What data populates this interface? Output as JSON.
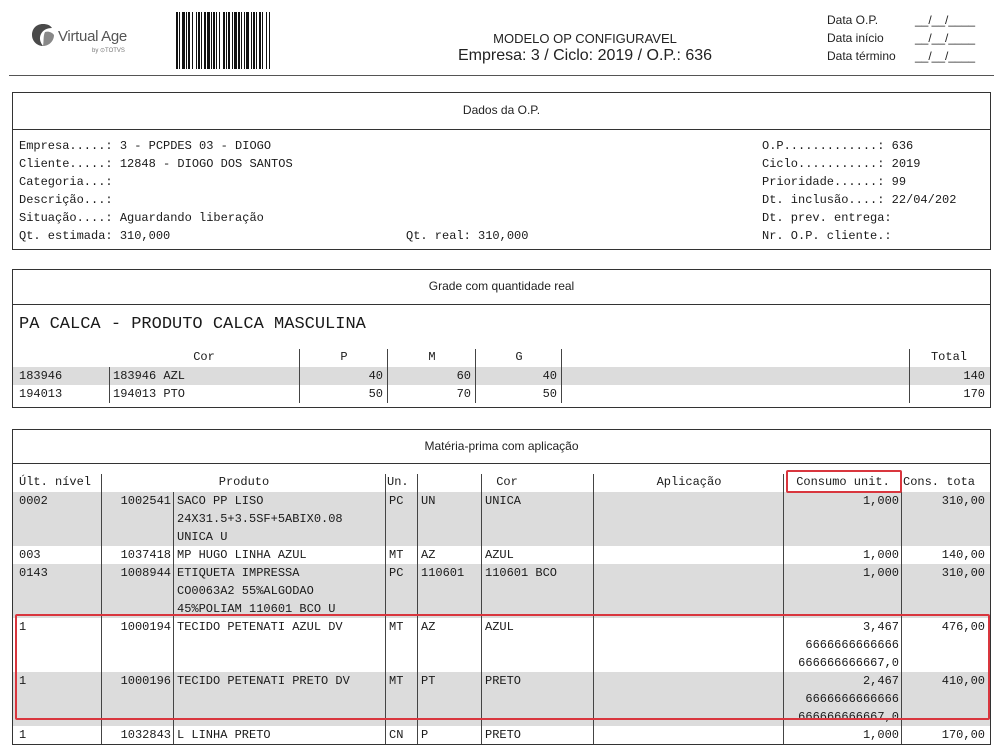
{
  "header": {
    "logo": {
      "brand": "Virtual Age",
      "sub": "by ⊙TOTVS"
    },
    "title": "MODELO OP CONFIGURAVEL",
    "subtitle": "Empresa: 3 / Ciclo: 2019 / O.P.: 636",
    "dates": [
      {
        "label": "Data O.P.",
        "value": "__/__/____"
      },
      {
        "label": "Data início",
        "value": "__/__/____"
      },
      {
        "label": "Data término",
        "value": "__/__/____"
      }
    ]
  },
  "dados": {
    "title": "Dados da O.P.",
    "left": [
      "Empresa.....: 3 - PCPDES 03 - DIOGO",
      "Cliente.....: 12848 - DIOGO DOS SANTOS",
      "Categoria...:",
      "Descrição...:",
      "Situação....: Aguardando liberação",
      "Qt. estimada: 310,000"
    ],
    "qt_real": "Qt. real: 310,000",
    "right": [
      "O.P.............: 636",
      "Ciclo...........: 2019",
      "Prioridade......: 99",
      "Dt. inclusão....: 22/04/202",
      "Dt. prev. entrega:",
      "Nr. O.P. cliente.:"
    ]
  },
  "grade": {
    "title": "Grade com quantidade real",
    "product": "PA CALCA - PRODUTO CALCA MASCULINA",
    "headers": {
      "cor": "Cor",
      "p": "P",
      "m": "M",
      "g": "G",
      "total": "Total"
    },
    "rows": [
      {
        "code": "183946",
        "cor": "183946 AZL",
        "p": "40",
        "m": "60",
        "g": "40",
        "total": "140"
      },
      {
        "code": "194013",
        "cor": "194013 PTO",
        "p": "50",
        "m": "70",
        "g": "50",
        "total": "170"
      }
    ]
  },
  "materia": {
    "title": "Matéria-prima com aplicação",
    "headers": {
      "nivel": "Últ. nível",
      "produto": "Produto",
      "un": "Un.",
      "cor": "Cor",
      "aplicacao": "Aplicação",
      "consumo": "Consumo unit.",
      "cons_total": "Cons. tota"
    },
    "rows": [
      {
        "nivel": "0002",
        "code": "1002541",
        "produto": [
          "SACO PP LISO",
          "24X31.5+3.5SF+5ABIX0.08",
          "UNICA U"
        ],
        "un": "PC",
        "cor_code": "UN",
        "cor": "UNICA",
        "aplicacao": "",
        "consumo": [
          "1,000"
        ],
        "cons_total": "310,00",
        "shaded": true
      },
      {
        "nivel": "003",
        "code": "1037418",
        "produto": [
          "MP HUGO LINHA AZUL"
        ],
        "un": "MT",
        "cor_code": "AZ",
        "cor": "AZUL",
        "aplicacao": "",
        "consumo": [
          "1,000"
        ],
        "cons_total": "140,00",
        "shaded": false
      },
      {
        "nivel": "0143",
        "code": "1008944",
        "produto": [
          "ETIQUETA IMPRESSA",
          "CO0063A2 55%ALGODAO",
          "45%POLIAM 110601 BCO U"
        ],
        "un": "PC",
        "cor_code": "110601",
        "cor": "110601 BCO",
        "aplicacao": "",
        "consumo": [
          "1,000"
        ],
        "cons_total": "310,00",
        "shaded": true
      },
      {
        "nivel": "1",
        "code": "1000194",
        "produto": [
          "TECIDO PETENATI AZUL DV"
        ],
        "un": "MT",
        "cor_code": "AZ",
        "cor": "AZUL",
        "aplicacao": "",
        "consumo": [
          "3,467",
          "6666666666666",
          "666666666667,0"
        ],
        "cons_total": "476,00",
        "shaded": false
      },
      {
        "nivel": "1",
        "code": "1000196",
        "produto": [
          "TECIDO PETENATI PRETO DV"
        ],
        "un": "MT",
        "cor_code": "PT",
        "cor": "PRETO",
        "aplicacao": "",
        "consumo": [
          "2,467",
          "6666666666666",
          "666666666667,0"
        ],
        "cons_total": "410,00",
        "shaded": true
      },
      {
        "nivel": "1",
        "code": "1032843",
        "produto": [
          "L LINHA PRETO"
        ],
        "un": "CN",
        "cor_code": "P",
        "cor": "PRETO",
        "aplicacao": "",
        "consumo": [
          "1,000"
        ],
        "cons_total": "170,00",
        "shaded": false
      }
    ]
  },
  "colors": {
    "highlight": "#d9363e",
    "row_shade": "#dcdcdc"
  }
}
